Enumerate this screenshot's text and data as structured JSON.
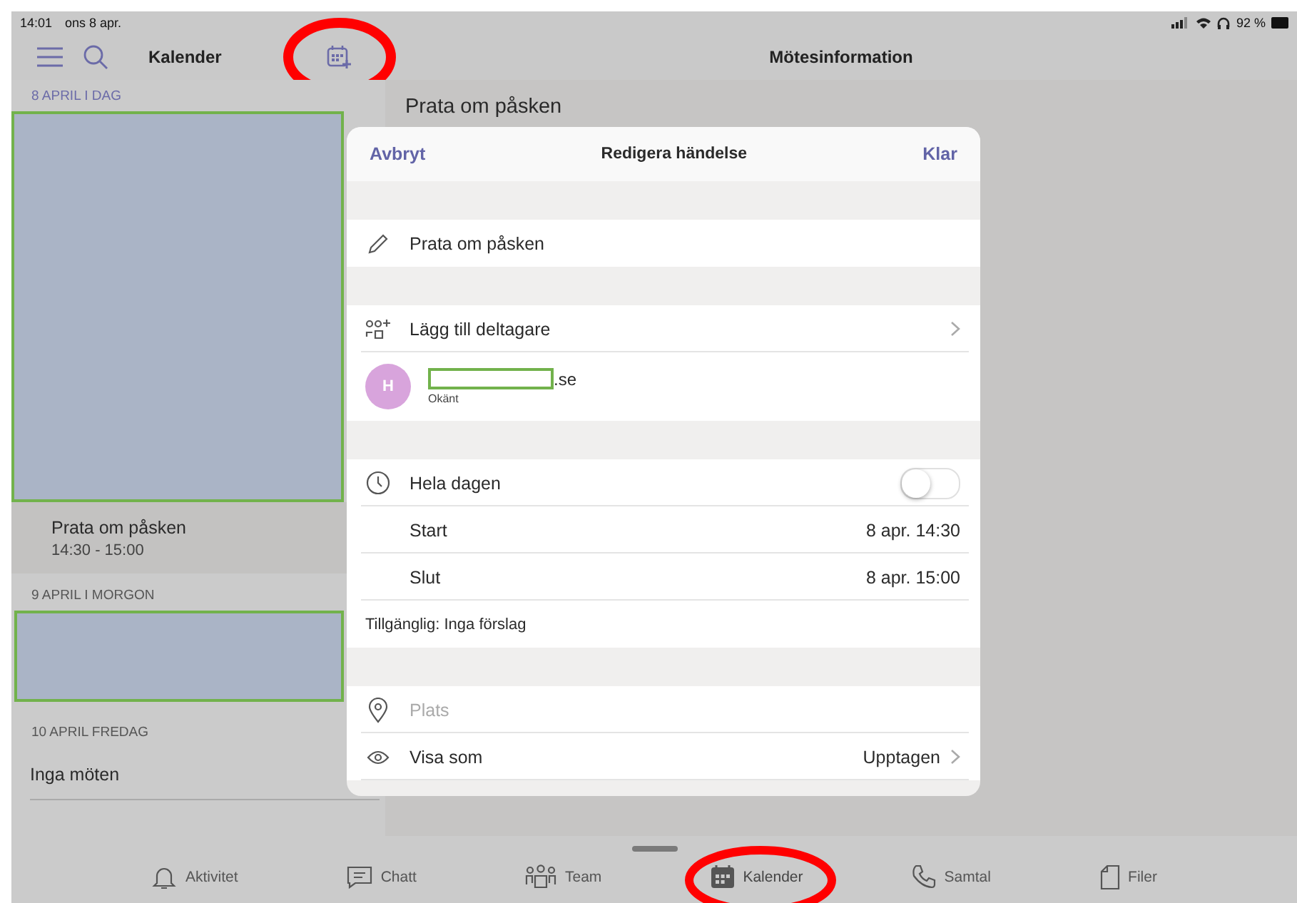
{
  "status_bar": {
    "time": "14:01",
    "date": "ons 8 apr.",
    "battery": "92 %"
  },
  "header": {
    "title": "Kalender",
    "new_event_circled": true,
    "detail_title": "Mötesinformation"
  },
  "agenda": [
    {
      "date_label": "8 APRIL  I DAG",
      "items": [
        {
          "kind": "redacted"
        },
        {
          "kind": "event",
          "title": "Prata om påsken",
          "time": "14:30 - 15:00"
        }
      ]
    },
    {
      "date_label": "9 APRIL  I MORGON",
      "items": [
        {
          "kind": "redacted"
        }
      ]
    },
    {
      "date_label": "10 APRIL  FREDAG",
      "items": [
        {
          "kind": "empty",
          "title": "Inga möten"
        }
      ]
    }
  ],
  "detail": {
    "meeting_title": "Prata om påsken"
  },
  "dialog": {
    "cancel": "Avbryt",
    "title": "Redigera händelse",
    "done": "Klar",
    "event_title": "Prata om påsken",
    "add_participants": "Lägg till deltagare",
    "participants": [
      {
        "initial": "H",
        "color": "#d8a4dc",
        "email_redacted": true,
        "email_suffix": ".se",
        "status": "Okänt"
      }
    ],
    "all_day": {
      "label": "Hela dagen",
      "on": false
    },
    "start": {
      "label": "Start",
      "value": "8 apr. 14:30"
    },
    "end": {
      "label": "Slut",
      "value": "8 apr. 15:00"
    },
    "availability": "Tillgänglig: Inga förslag",
    "location": {
      "placeholder": "Plats"
    },
    "show_as": {
      "label": "Visa som",
      "value": "Upptagen"
    }
  },
  "tabs": [
    {
      "label": "Aktivitet",
      "selected": false,
      "circled": false
    },
    {
      "label": "Chatt",
      "selected": false,
      "circled": false
    },
    {
      "label": "Team",
      "selected": false,
      "circled": false
    },
    {
      "label": "Kalender",
      "selected": true,
      "circled": true
    },
    {
      "label": "Samtal",
      "selected": false,
      "circled": false
    },
    {
      "label": "Filer",
      "selected": false,
      "circled": false
    }
  ]
}
